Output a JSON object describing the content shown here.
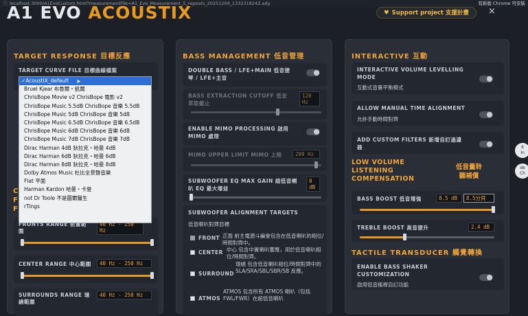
{
  "browser": {
    "url": "localhost:3000/A1EvoCustom.html?measurementFile=A1_Evo_Measurement_5_repeats_20251204_133231824Z.ady",
    "update_label": "有新版 Chrome 可安裝"
  },
  "app": {
    "title_part1": "A1 EVO",
    "title_part2": "ACOUSTIX",
    "support_label": "Support project  支援計畫",
    "close_symbol": "×"
  },
  "target": {
    "section_title": "TARGET RESPONSE  目標反應",
    "curve_file_label": "TARGET CURVE FILE  目標曲線檔案",
    "curve_options": [
      "✓AcoustiX_default",
      "Bruel Kjear 布魯爾・凱爾",
      "ChrisBope Movie v2  ChrisBope 電影 v2",
      "ChrisBope Music 5.5dB  ChrisBope 音樂 5.5dB",
      "ChrisBope Music 5dB  ChrisBope 音樂 5dB",
      "ChrisBope Music 6.5dB  ChrisBope 音樂 6.5dB",
      "ChrisBope Music 6dB  ChrisBope 音樂 6dB",
      "ChrisBope Music 7dB  ChrisBope 音樂 7dB",
      "Dirac Harman 4dB  狄拉克・哈曼 4dB",
      "Dirac Harman 6dB  狄拉克・哈曼 6dB",
      "Dirac Harman 8dB  狄拉克・哈曼 8dB",
      "Dolby Atmos Music  杜比全景聲音樂",
      "Flat  平面",
      "Harman Kardon  哈曼・卡登",
      "not Dr Toole  不是圖爾醫生",
      "rTings"
    ],
    "fronts_range_label": "FRONTS RANGE  前置範圍",
    "fronts_range_value": "40 Hz - 250 Hz",
    "center_range_label": "CENTER RANGE  中心範圍",
    "center_range_value": "40 Hz - 250 Hz",
    "surrounds_range_label": "SURROUNDS RANGE  環繞範圍",
    "surrounds_range_value": "40 Hz - 250 Hz"
  },
  "bass": {
    "section_title": "BASS MANAGEMENT  低音管理",
    "double_bass_label": "DOUBLE BASS / LFE+MAIN  低音提琴 / LFE+主音",
    "extraction_label": "BASS EXTRACTION CUTOFF  低音萃取截止",
    "extraction_value": "120 Hz",
    "mimo_label": "ENABLE MIMO PROCESSING  啟用 MIMO 處理",
    "mimo_upper_label": "MIMO UPPER LIMIT  MIMO 上限",
    "mimo_upper_value": "200 Hz",
    "sub_eq_label": "SUBWOOFER EQ MAX GAIN  超低音喇叭 EQ 最大增益",
    "sub_eq_value": "0 dB",
    "sub_align_label": "SUBWOOFER ALIGNMENT TARGETS",
    "sub_align_sub": "低音喇叭對齊目標",
    "front_label": "FRONT",
    "front_desc": "正面  前主電源斗編會包含在低音喇叭的相位/時間對齊中。",
    "center_label": "CENTER",
    "center_desc": "中心  包含中置喇叭響應，用於低音喇叭相位/時間對齊。",
    "surround_label": "SURROUND",
    "surround_desc": "環繞  包含低音喇叭相位/時間對齊中的 SLA/SRA/SBL/SBR/SB 反應。",
    "atmos_label": "ATMOS",
    "atmos_desc": "ATMOS 包含所有 ATMOS 喇叭（包括 FWL/FWR）在超低音喇叭"
  },
  "interactive": {
    "section_title": "INTERACTIVE  互動",
    "ivl_label": "INTERACTIVE VOLUME LEVELLING MODE",
    "ivl_sub": "互動式音量平衡模式",
    "manual_label": "ALLOW MANUAL TIME ALIGNMENT",
    "manual_sub": "允許手動時間對齊",
    "filters_label": "ADD CUSTOM FILTERS  新增自訂過濾器",
    "lvc_title": "LOW VOLUME LISTENING COMPENSATION",
    "lvc_title_zh": "低音量聆聽補償",
    "bass_boost_label": "BASS BOOST  低音增強",
    "bass_boost_value1": "8.5 dB",
    "bass_boost_value2": "8.5分貝",
    "treble_label": "TREBLE BOOST  高音提升",
    "treble_value": "2.4 dB",
    "tactile_title": "TACTILE TRANSDUCER  觸覺轉換",
    "shaker_label": "ENABLE BASS SHAKER CUSTOMIZATION",
    "shaker_sub": "啟用低音搖桿自訂功能"
  },
  "colors": {
    "accent": "#e89a1f",
    "panel": "#2a2f37",
    "background": "#1c2026"
  }
}
